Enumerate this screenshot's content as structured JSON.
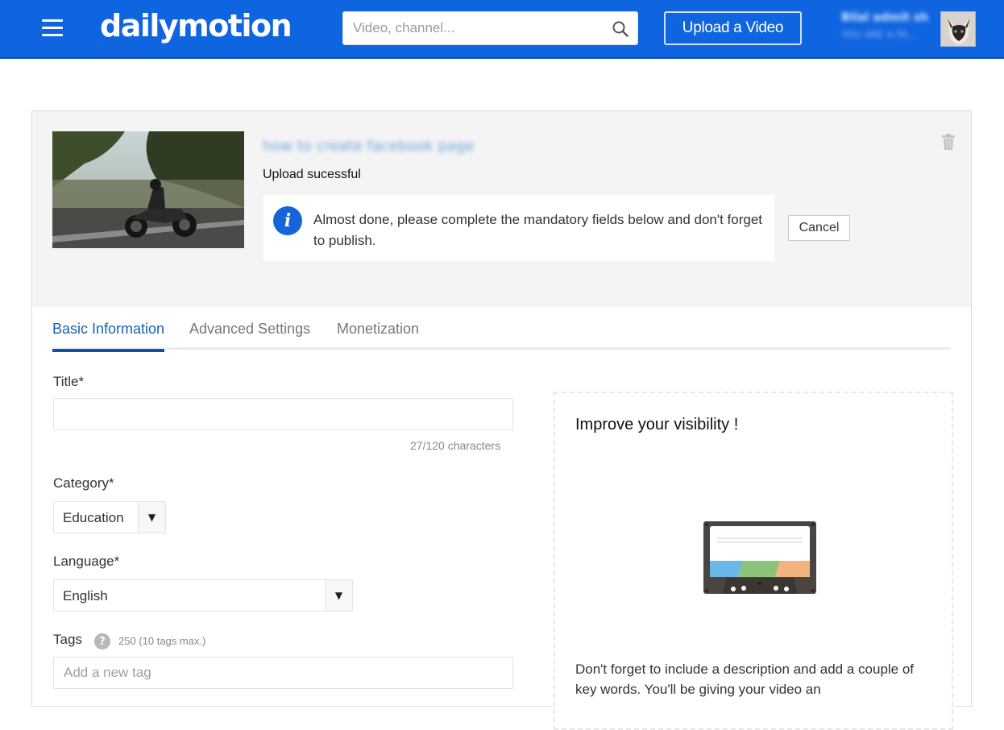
{
  "header": {
    "logo": "dailymotion",
    "search_placeholder": "Video, channel...",
    "upload_button": "Upload a Video",
    "user_name": "Bilal admit sh...",
    "user_subtitle": "YOU ARE A FA...",
    "brand_color": "#0f64e0"
  },
  "upload": {
    "video_title": "how to create facebook page",
    "status": "Upload sucessful",
    "notice": "Almost done, please complete the mandatory fields below and don't forget to publish.",
    "cancel_button": "Cancel"
  },
  "tabs": [
    {
      "label": "Basic Information",
      "active": true
    },
    {
      "label": "Advanced Settings",
      "active": false
    },
    {
      "label": "Monetization",
      "active": false
    }
  ],
  "form": {
    "title_label": "Title*",
    "title_value": "",
    "title_count": "27/120 characters",
    "category_label": "Category*",
    "category_value": "Education",
    "language_label": "Language*",
    "language_value": "English",
    "tags_label": "Tags",
    "tags_hint": "250 (10 tags max.)",
    "tags_placeholder": "Add a new tag"
  },
  "visibility": {
    "title": "Improve your visibility !",
    "text": "Don't forget to include a description and add a couple of key words. You'll be giving your video an"
  }
}
